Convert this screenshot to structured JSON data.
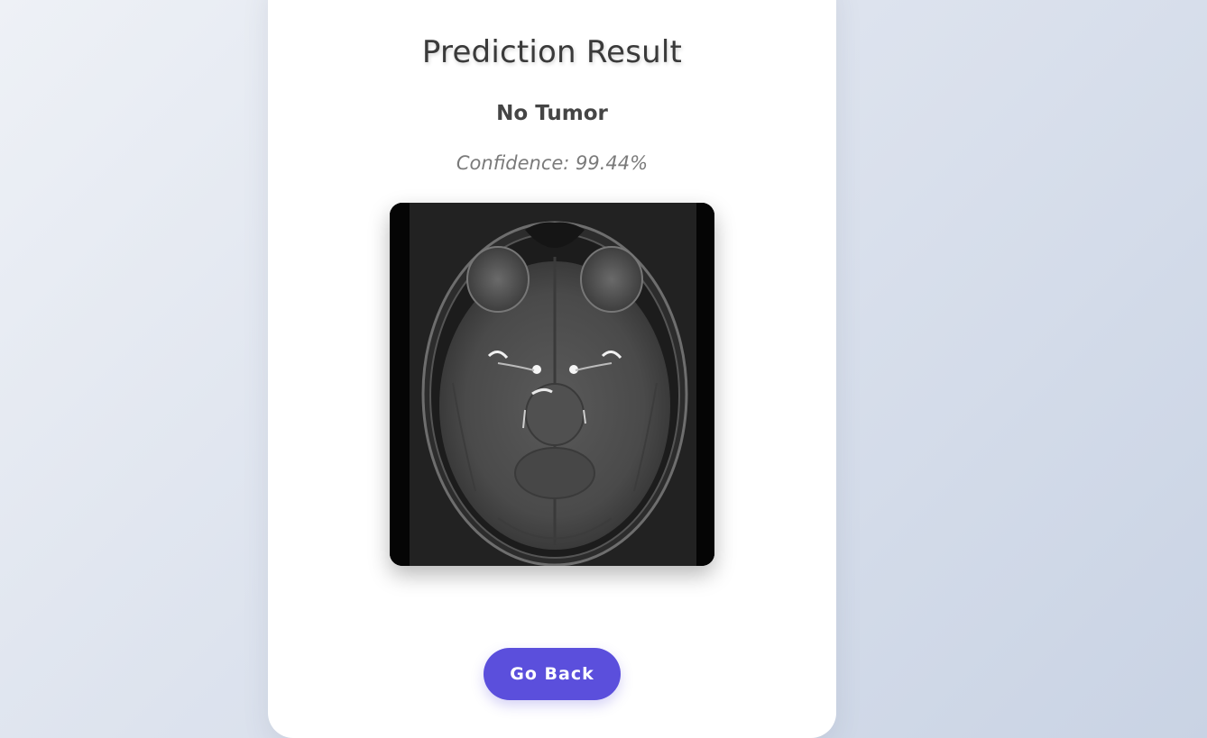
{
  "result_card": {
    "title": "Prediction Result",
    "prediction": "No Tumor",
    "confidence": "Confidence: 99.44%"
  },
  "actions": {
    "go_back_label": "Go Back"
  },
  "colors": {
    "button": "#5b4fdc",
    "title": "#3a3a3a",
    "confidence": "#7a7a7a"
  }
}
